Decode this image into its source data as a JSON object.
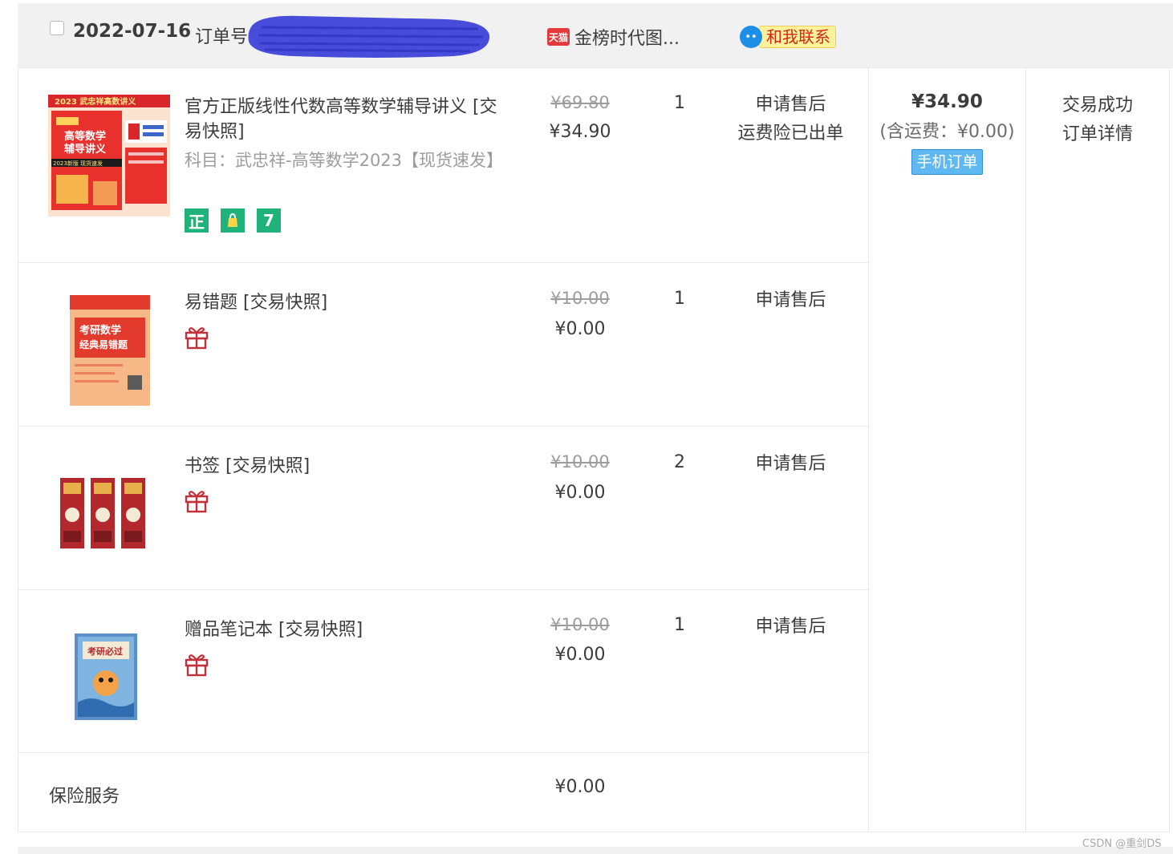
{
  "header": {
    "date": "2022-07-16",
    "order_no_label": "订单号",
    "shop_icon_text": "天猫",
    "shop_name": "金榜时代图...",
    "contact_label": "和我联系"
  },
  "items": [
    {
      "title": "官方正版线性代数高等数学辅导讲义 [交易快照]",
      "spec": "科目：武忠祥-高等数学2023【现货速发】",
      "badges": [
        "正",
        "",
        "7"
      ],
      "orig_price": "¥69.80",
      "price": "¥34.90",
      "qty": "1",
      "aftersale": "申请售后",
      "aftersale_note": "运费险已出单",
      "cover_text": [
        "2023 武忠祥高数讲义",
        "高等数学",
        "辅导讲义",
        "2023新版 现货速发"
      ]
    },
    {
      "title": "易错题 [交易快照]",
      "orig_price": "¥10.00",
      "price": "¥0.00",
      "qty": "1",
      "aftersale": "申请售后",
      "cover_text": [
        "考研数学",
        "经典易错题"
      ]
    },
    {
      "title": "书签 [交易快照]",
      "orig_price": "¥10.00",
      "price": "¥0.00",
      "qty": "2",
      "aftersale": "申请售后"
    },
    {
      "title": "赠品笔记本 [交易快照]",
      "orig_price": "¥10.00",
      "price": "¥0.00",
      "qty": "1",
      "aftersale": "申请售后",
      "cover_text": [
        "考研必过"
      ]
    }
  ],
  "insurance": {
    "label": "保险服务",
    "price": "¥0.00"
  },
  "total": {
    "price": "¥34.90",
    "shipping": "(含运费：¥0.00)",
    "mobile_tag": "手机订单"
  },
  "status": {
    "text": "交易成功",
    "detail_link": "订单详情"
  },
  "watermark": "CSDN @重剑DS",
  "colors": {
    "header_bg": "#f1f1f1",
    "badge_green": "#1fb37b",
    "gift_red": "#c3303a",
    "tmall_red": "#e4393c",
    "mobile_tag_blue": "#5fb8ef",
    "redaction_blue": "#3b3fd8"
  }
}
